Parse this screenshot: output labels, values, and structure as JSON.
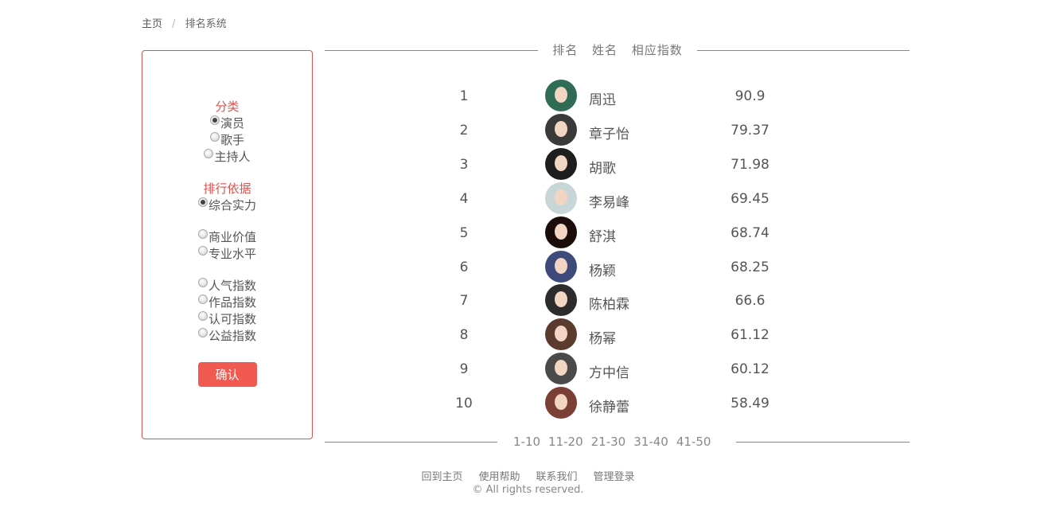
{
  "breadcrumb": {
    "home": "主页",
    "separator": "/",
    "current": "排名系统"
  },
  "filters": {
    "category_title": "分类",
    "categories": [
      {
        "label": "演员",
        "checked": true
      },
      {
        "label": "歌手",
        "checked": false
      },
      {
        "label": "主持人",
        "checked": false
      }
    ],
    "basis_title": "排行依据",
    "basis_groups": [
      [
        {
          "label": "综合实力",
          "checked": true
        }
      ],
      [
        {
          "label": "商业价值",
          "checked": false
        },
        {
          "label": "专业水平",
          "checked": false
        }
      ],
      [
        {
          "label": "人气指数",
          "checked": false
        },
        {
          "label": "作品指数",
          "checked": false
        },
        {
          "label": "认可指数",
          "checked": false
        },
        {
          "label": "公益指数",
          "checked": false
        }
      ]
    ],
    "confirm_label": "确认"
  },
  "table": {
    "headers": {
      "rank": "排名",
      "name": "姓名",
      "index": "相应指数"
    },
    "rows": [
      {
        "rank": "1",
        "name": "周迅",
        "score": "90.9",
        "avatar_color": "#2f6b55"
      },
      {
        "rank": "2",
        "name": "章子怡",
        "score": "79.37",
        "avatar_color": "#3a3a3a"
      },
      {
        "rank": "3",
        "name": "胡歌",
        "score": "71.98",
        "avatar_color": "#1e1e1e"
      },
      {
        "rank": "4",
        "name": "李易峰",
        "score": "69.45",
        "avatar_color": "#c9d6d8"
      },
      {
        "rank": "5",
        "name": "舒淇",
        "score": "68.74",
        "avatar_color": "#1a0d0a"
      },
      {
        "rank": "6",
        "name": "杨颖",
        "score": "68.25",
        "avatar_color": "#3d4a7a"
      },
      {
        "rank": "7",
        "name": "陈柏霖",
        "score": "66.6",
        "avatar_color": "#2c2c2c"
      },
      {
        "rank": "8",
        "name": "杨幂",
        "score": "61.12",
        "avatar_color": "#5a3b2e"
      },
      {
        "rank": "9",
        "name": "方中信",
        "score": "60.12",
        "avatar_color": "#4a4a4a"
      },
      {
        "rank": "10",
        "name": "徐静蕾",
        "score": "58.49",
        "avatar_color": "#7a3f35"
      }
    ]
  },
  "pagination": [
    "1-10",
    "11-20",
    "21-30",
    "31-40",
    "41-50"
  ],
  "footer": {
    "links": [
      "回到主页",
      "使用帮助",
      "联系我们",
      "管理登录"
    ],
    "copyright": "© All rights reserved."
  }
}
